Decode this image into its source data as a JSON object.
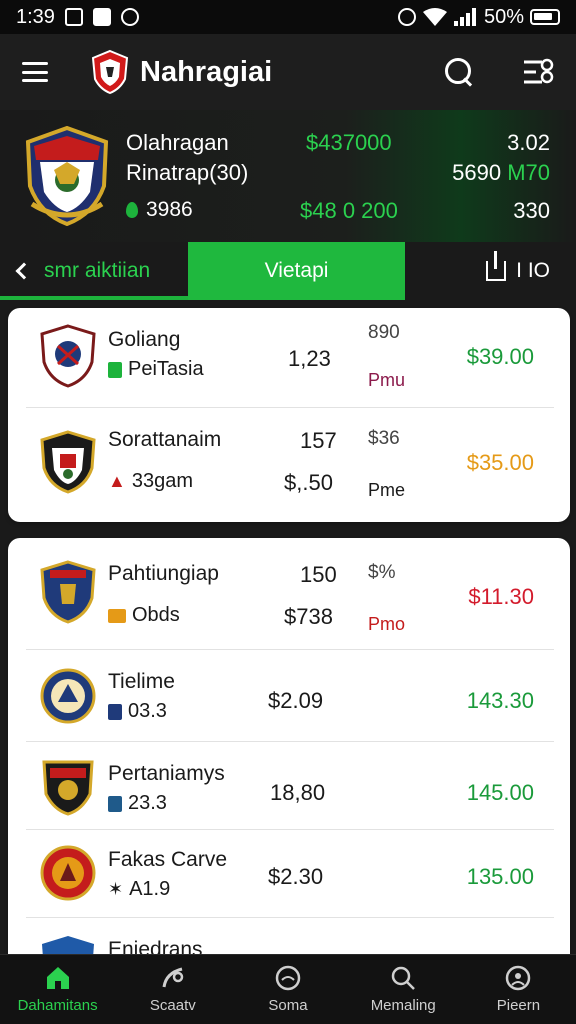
{
  "status_bar": {
    "time": "1:39",
    "battery": "50%"
  },
  "app": {
    "title": "Nahragiai"
  },
  "summary": {
    "name_line1": "Olahragan",
    "name_line2": "Rinatrap(30)",
    "stat": "3986",
    "green_top": "$437000",
    "green_bottom": "$48 0 200",
    "right_top": "3.02",
    "right_mid_a": "5690",
    "right_mid_b": "M70",
    "right_bottom": "330"
  },
  "tabs": {
    "back": "smr aiktiian",
    "active": "Vietapi",
    "share": "I IO"
  },
  "card1_rows": [
    {
      "team": "Goliang",
      "sub": "PeiTasia",
      "mid": "1,23",
      "pct": "890",
      "pmu": "Pmu",
      "price": "$39.00",
      "price_color": "#1a9a3a",
      "crest": "c1"
    },
    {
      "team": "Sorattanaim",
      "sub": "33gam",
      "mid_top": "157",
      "mid": "$,.50",
      "pct": "$36",
      "pmu": "Pme",
      "price": "$35.00",
      "price_color": "#e59a17",
      "crest": "c2"
    }
  ],
  "card2_rows": [
    {
      "team": "Pahtiungiap",
      "sub": "Obds",
      "mid_top": "150",
      "mid": "$738",
      "pct": "$%",
      "pmu": "Pmo",
      "price": "$11.30",
      "price_color": "#d31b2c",
      "crest": "c3"
    },
    {
      "team": "Tielime",
      "sub": "03.3",
      "mid": "$2.09",
      "price": "143.30",
      "price_color": "#1a9a3a",
      "crest": "c4"
    },
    {
      "team": "Pertaniamys",
      "sub": "23.3",
      "mid": "18,80",
      "price": "145.00",
      "price_color": "#1a9a3a",
      "crest": "c5"
    },
    {
      "team": "Fakas Carve",
      "sub": "A1.9",
      "mid": "$2.30",
      "price": "135.00",
      "price_color": "#1a9a3a",
      "crest": "c6"
    },
    {
      "team": "Eniedrans",
      "crest": "c7"
    }
  ],
  "bottom_nav": [
    {
      "label": "Dahamitans",
      "icon": "home-icon",
      "active": true
    },
    {
      "label": "Scaatv",
      "icon": "sports-icon",
      "active": false
    },
    {
      "label": "Soma",
      "icon": "circle-icon",
      "active": false
    },
    {
      "label": "Memaling",
      "icon": "search-icon",
      "active": false
    },
    {
      "label": "Pieern",
      "icon": "profile-icon",
      "active": false
    }
  ],
  "colors": {
    "accent": "#1fb83e",
    "background": "#1a1a1a",
    "card": "#ffffff"
  }
}
